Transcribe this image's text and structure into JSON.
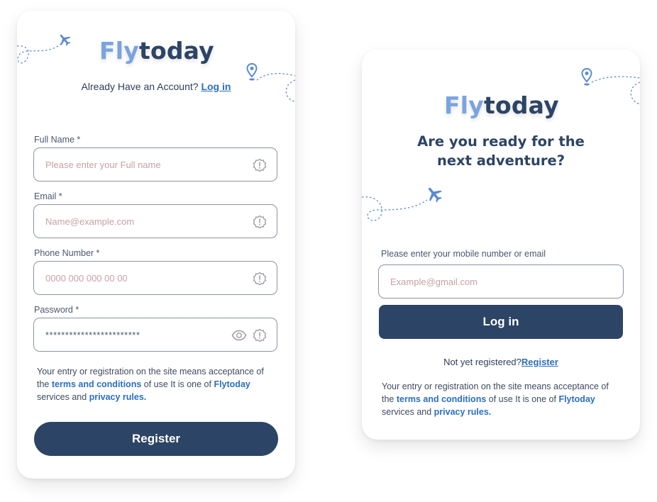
{
  "register_card": {
    "logo": {
      "part1": "Fly",
      "part2": "today"
    },
    "already_text": "Already Have an Account?",
    "login_link": "Log in",
    "fields": [
      {
        "label": "Full Name *",
        "placeholder": "Please enter your Full name",
        "value": ""
      },
      {
        "label": "Email *",
        "placeholder": "Name@example.com",
        "value": ""
      },
      {
        "label": "Phone Number *",
        "placeholder": "0000 000 000 00 00",
        "value": ""
      },
      {
        "label": "Password *",
        "placeholder": "",
        "value": "************************"
      }
    ],
    "terms": {
      "prefix": "Your entry or registration on the site means acceptance of the",
      "terms_link": "terms and conditions",
      "middle": "of use It is one of",
      "brand": "Flytoday",
      "services": "services and",
      "privacy_link": "privacy rules."
    },
    "register_button": "Register"
  },
  "login_card": {
    "logo": {
      "part1": "Fly",
      "part2": "today"
    },
    "headline_line1": "Are you ready for the",
    "headline_line2": "next adventure?",
    "field_label": "Please enter your mobile number or email",
    "field_placeholder": "Example@gmail.com",
    "login_button": "Log in",
    "not_registered": "Not yet registered?",
    "register_link": "Register",
    "terms": {
      "prefix": "Your entry or registration on the site means acceptance of the",
      "terms_link": "terms and conditions",
      "middle": "of use It is one of",
      "brand": "Flytoday",
      "services": "services and",
      "privacy_link": "privacy rules."
    }
  },
  "icons": [
    "airplane-icon",
    "map-pin-icon",
    "alert-badge-icon",
    "eye-icon"
  ],
  "colors": {
    "primary": "#2c4465",
    "logo_light": "#7ba4df",
    "link": "#2a6fc0",
    "placeholder": "#c7a0a9",
    "decoration": "#5b8ad0"
  }
}
